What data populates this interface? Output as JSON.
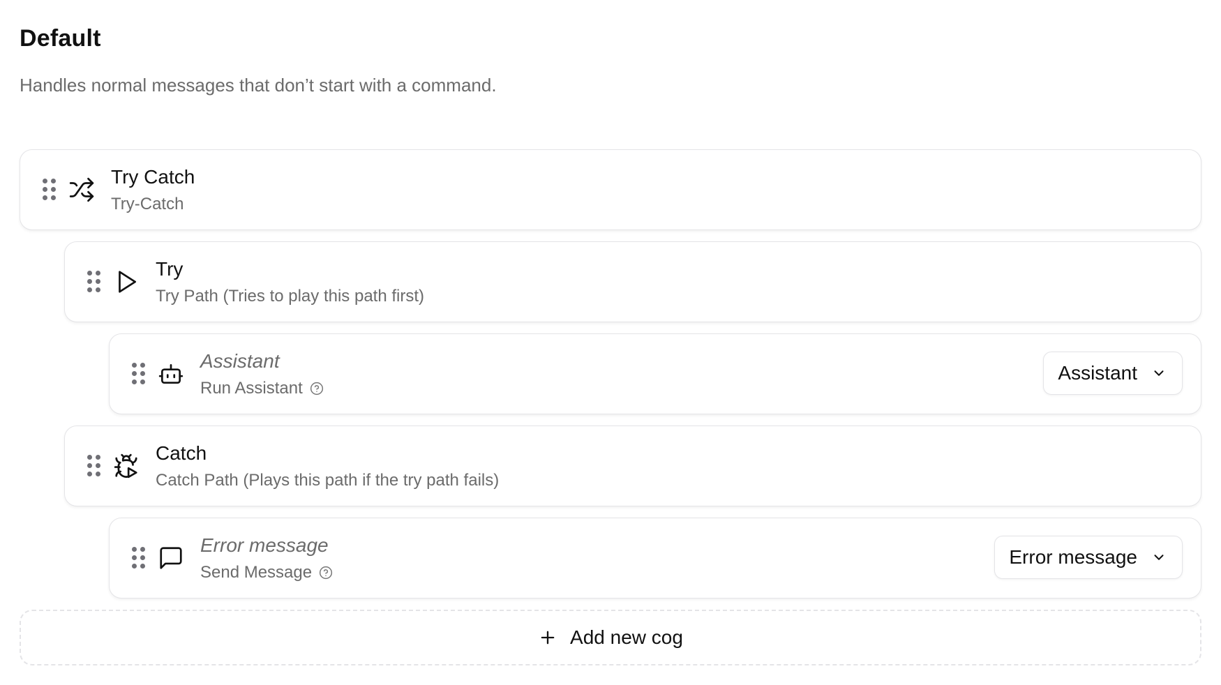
{
  "section": {
    "title": "Default",
    "subtitle": "Handles normal messages that don’t start with a command."
  },
  "cogs": [
    {
      "name": "Try Catch",
      "description": "Try-Catch",
      "icon": "shuffle-icon"
    },
    {
      "name": "Try",
      "description": "Try Path (Tries to play this path first)",
      "icon": "play-icon"
    },
    {
      "name": "Assistant",
      "description": "Run Assistant",
      "icon": "bot-icon",
      "select_value": "Assistant"
    },
    {
      "name": "Catch",
      "description": "Catch Path (Plays this path if the try path fails)",
      "icon": "bug-play-icon"
    },
    {
      "name": "Error message",
      "description": "Send Message",
      "icon": "message-square-icon",
      "select_value": "Error message"
    }
  ],
  "add_button": {
    "label": "Add new cog",
    "icon": "plus-icon"
  },
  "colors": {
    "border": "#e4e4e7",
    "muted_text": "#6b6b6b",
    "text": "#111111"
  }
}
